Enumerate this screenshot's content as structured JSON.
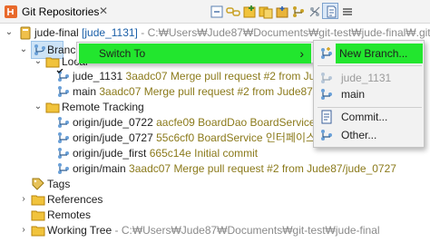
{
  "view": {
    "title": "Git Repositories",
    "close_glyph": "✕",
    "toolbar_icons": [
      "collapse-all-icon",
      "link-with-selection-icon",
      "add-repository-icon",
      "clone-repository-icon",
      "create-repository-icon",
      "branch-tree-icon",
      "filter-icon",
      "hierarchical-layout-icon",
      "view-menu-icon"
    ]
  },
  "tree": {
    "repo": {
      "name": "jude-final",
      "branch": "[jude_1131]",
      "path": "- C:₩Users₩Jude87₩Documents₩git-test₩jude-final₩.git"
    },
    "branches_label": "Branc",
    "local_label": "Local",
    "local_branches": [
      {
        "name": "jude_1131",
        "hash": "3aadc07",
        "message": "Merge pull request #2 from Jude87/jude_0"
      },
      {
        "name": "main",
        "hash": "3aadc07",
        "message": "Merge pull request #2 from Jude87/jude_0"
      }
    ],
    "remote_label": "Remote Tracking",
    "remote_branches": [
      {
        "name": "origin/jude_0722",
        "hash": "aacfe09",
        "message": "BoardDao BoardServiceImpl"
      },
      {
        "name": "origin/jude_0727",
        "hash": "55c6cf0",
        "message": "BoardService 인터페이스 생성"
      },
      {
        "name": "origin/jude_first",
        "hash": "665c14e",
        "message": "Initial commit"
      },
      {
        "name": "origin/main",
        "hash": "3aadc07",
        "message": "Merge pull request #2 from Jude87/jude_0727"
      }
    ],
    "tags_label": "Tags",
    "references_label": "References",
    "remotes_label": "Remotes",
    "working_tree": {
      "label": "Working Tree",
      "path": "- C:₩Users₩Jude87₩Documents₩git-test₩jude-final"
    }
  },
  "context_menu": {
    "switch_to_label": "Switch To",
    "arrow": "›"
  },
  "submenu": {
    "new_branch": "New Branch...",
    "current_branch": "jude_1131",
    "main": "main",
    "commit": "Commit...",
    "other": "Other..."
  },
  "colors": {
    "highlight": "#22e62e",
    "selection": "#cde3f6",
    "path_text": "#8a8a8a",
    "commit_text": "#8b7a1b"
  }
}
